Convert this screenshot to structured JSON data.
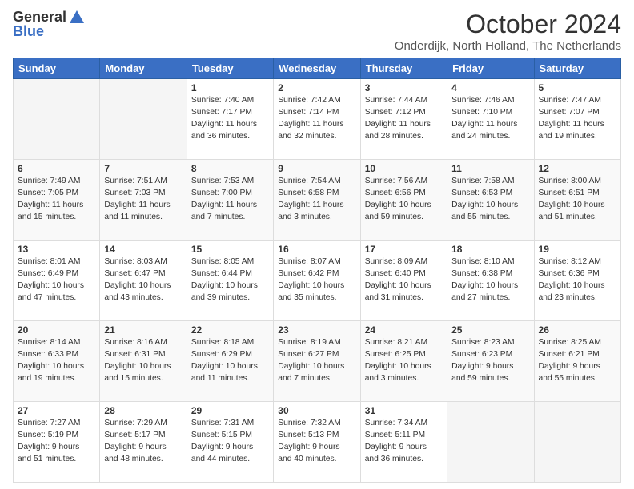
{
  "logo": {
    "general": "General",
    "blue": "Blue"
  },
  "header": {
    "month": "October 2024",
    "location": "Onderdijk, North Holland, The Netherlands"
  },
  "weekdays": [
    "Sunday",
    "Monday",
    "Tuesday",
    "Wednesday",
    "Thursday",
    "Friday",
    "Saturday"
  ],
  "weeks": [
    [
      {
        "day": "",
        "content": ""
      },
      {
        "day": "",
        "content": ""
      },
      {
        "day": "1",
        "content": "Sunrise: 7:40 AM\nSunset: 7:17 PM\nDaylight: 11 hours\nand 36 minutes."
      },
      {
        "day": "2",
        "content": "Sunrise: 7:42 AM\nSunset: 7:14 PM\nDaylight: 11 hours\nand 32 minutes."
      },
      {
        "day": "3",
        "content": "Sunrise: 7:44 AM\nSunset: 7:12 PM\nDaylight: 11 hours\nand 28 minutes."
      },
      {
        "day": "4",
        "content": "Sunrise: 7:46 AM\nSunset: 7:10 PM\nDaylight: 11 hours\nand 24 minutes."
      },
      {
        "day": "5",
        "content": "Sunrise: 7:47 AM\nSunset: 7:07 PM\nDaylight: 11 hours\nand 19 minutes."
      }
    ],
    [
      {
        "day": "6",
        "content": "Sunrise: 7:49 AM\nSunset: 7:05 PM\nDaylight: 11 hours\nand 15 minutes."
      },
      {
        "day": "7",
        "content": "Sunrise: 7:51 AM\nSunset: 7:03 PM\nDaylight: 11 hours\nand 11 minutes."
      },
      {
        "day": "8",
        "content": "Sunrise: 7:53 AM\nSunset: 7:00 PM\nDaylight: 11 hours\nand 7 minutes."
      },
      {
        "day": "9",
        "content": "Sunrise: 7:54 AM\nSunset: 6:58 PM\nDaylight: 11 hours\nand 3 minutes."
      },
      {
        "day": "10",
        "content": "Sunrise: 7:56 AM\nSunset: 6:56 PM\nDaylight: 10 hours\nand 59 minutes."
      },
      {
        "day": "11",
        "content": "Sunrise: 7:58 AM\nSunset: 6:53 PM\nDaylight: 10 hours\nand 55 minutes."
      },
      {
        "day": "12",
        "content": "Sunrise: 8:00 AM\nSunset: 6:51 PM\nDaylight: 10 hours\nand 51 minutes."
      }
    ],
    [
      {
        "day": "13",
        "content": "Sunrise: 8:01 AM\nSunset: 6:49 PM\nDaylight: 10 hours\nand 47 minutes."
      },
      {
        "day": "14",
        "content": "Sunrise: 8:03 AM\nSunset: 6:47 PM\nDaylight: 10 hours\nand 43 minutes."
      },
      {
        "day": "15",
        "content": "Sunrise: 8:05 AM\nSunset: 6:44 PM\nDaylight: 10 hours\nand 39 minutes."
      },
      {
        "day": "16",
        "content": "Sunrise: 8:07 AM\nSunset: 6:42 PM\nDaylight: 10 hours\nand 35 minutes."
      },
      {
        "day": "17",
        "content": "Sunrise: 8:09 AM\nSunset: 6:40 PM\nDaylight: 10 hours\nand 31 minutes."
      },
      {
        "day": "18",
        "content": "Sunrise: 8:10 AM\nSunset: 6:38 PM\nDaylight: 10 hours\nand 27 minutes."
      },
      {
        "day": "19",
        "content": "Sunrise: 8:12 AM\nSunset: 6:36 PM\nDaylight: 10 hours\nand 23 minutes."
      }
    ],
    [
      {
        "day": "20",
        "content": "Sunrise: 8:14 AM\nSunset: 6:33 PM\nDaylight: 10 hours\nand 19 minutes."
      },
      {
        "day": "21",
        "content": "Sunrise: 8:16 AM\nSunset: 6:31 PM\nDaylight: 10 hours\nand 15 minutes."
      },
      {
        "day": "22",
        "content": "Sunrise: 8:18 AM\nSunset: 6:29 PM\nDaylight: 10 hours\nand 11 minutes."
      },
      {
        "day": "23",
        "content": "Sunrise: 8:19 AM\nSunset: 6:27 PM\nDaylight: 10 hours\nand 7 minutes."
      },
      {
        "day": "24",
        "content": "Sunrise: 8:21 AM\nSunset: 6:25 PM\nDaylight: 10 hours\nand 3 minutes."
      },
      {
        "day": "25",
        "content": "Sunrise: 8:23 AM\nSunset: 6:23 PM\nDaylight: 9 hours\nand 59 minutes."
      },
      {
        "day": "26",
        "content": "Sunrise: 8:25 AM\nSunset: 6:21 PM\nDaylight: 9 hours\nand 55 minutes."
      }
    ],
    [
      {
        "day": "27",
        "content": "Sunrise: 7:27 AM\nSunset: 5:19 PM\nDaylight: 9 hours\nand 51 minutes."
      },
      {
        "day": "28",
        "content": "Sunrise: 7:29 AM\nSunset: 5:17 PM\nDaylight: 9 hours\nand 48 minutes."
      },
      {
        "day": "29",
        "content": "Sunrise: 7:31 AM\nSunset: 5:15 PM\nDaylight: 9 hours\nand 44 minutes."
      },
      {
        "day": "30",
        "content": "Sunrise: 7:32 AM\nSunset: 5:13 PM\nDaylight: 9 hours\nand 40 minutes."
      },
      {
        "day": "31",
        "content": "Sunrise: 7:34 AM\nSunset: 5:11 PM\nDaylight: 9 hours\nand 36 minutes."
      },
      {
        "day": "",
        "content": ""
      },
      {
        "day": "",
        "content": ""
      }
    ]
  ]
}
